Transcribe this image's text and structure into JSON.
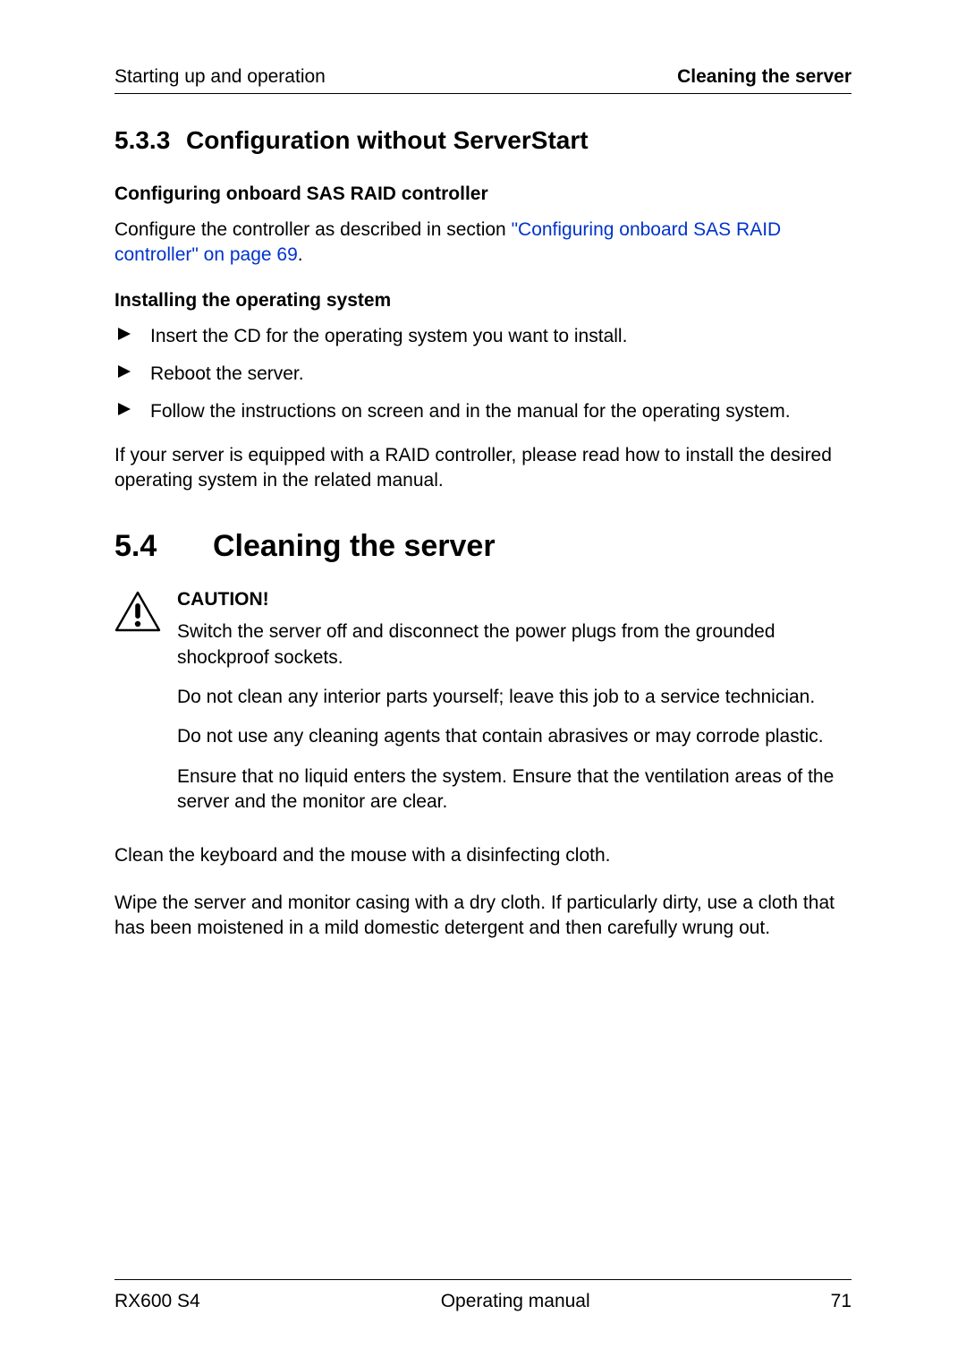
{
  "header": {
    "left": "Starting up and operation",
    "right": "Cleaning the server"
  },
  "section533": {
    "number": "5.3.3",
    "title": "Configuration without ServerStart"
  },
  "sas": {
    "heading": "Configuring onboard SAS RAID controller",
    "intro": "Configure the controller as described in section ",
    "link": "\"Configuring onboard SAS RAID controller\" on page 69",
    "after": "."
  },
  "install": {
    "heading": "Installing the operating system",
    "steps": [
      "Insert the CD for the operating system you want to install.",
      "Reboot the server.",
      "Follow the instructions on screen and in the manual for the operating system."
    ],
    "note": "If your server is equipped with a RAID controller, please read how to install the desired operating system in the related manual."
  },
  "section54": {
    "number": "5.4",
    "title": "Cleaning the server"
  },
  "caution": {
    "title": "CAUTION!",
    "paras": [
      "Switch the server off and disconnect the power plugs from the grounded shockproof sockets.",
      "Do not clean any interior parts yourself; leave this job to a service technician.",
      "Do not use any cleaning agents that contain abrasives or may corrode plastic.",
      "Ensure that no liquid enters the system. Ensure that the ventilation areas of the server and the monitor are clear."
    ]
  },
  "cleaning": {
    "p1": "Clean the keyboard and the mouse with a disinfecting cloth.",
    "p2": "Wipe the server and monitor casing with a dry cloth. If particularly dirty, use a cloth that has been moistened in a mild domestic detergent and then carefully wrung out."
  },
  "footer": {
    "left": "RX600 S4",
    "center": "Operating manual",
    "right": "71"
  }
}
